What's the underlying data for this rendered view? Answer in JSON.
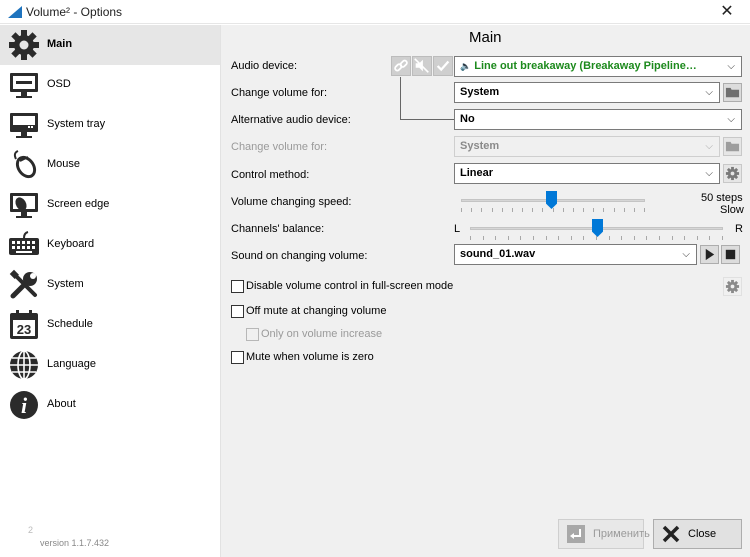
{
  "window": {
    "title": "Volume² - Options",
    "close_glyph": "✕",
    "version": "version 1.1.7.432",
    "logo_mark": "2"
  },
  "sidebar": {
    "items": [
      {
        "label": "Main",
        "icon": "gear-icon",
        "active": true
      },
      {
        "label": "OSD",
        "icon": "monitor-icon"
      },
      {
        "label": "System tray",
        "icon": "tray-icon"
      },
      {
        "label": "Mouse",
        "icon": "mouse-icon"
      },
      {
        "label": "Screen edge",
        "icon": "screen-edge-icon"
      },
      {
        "label": "Keyboard",
        "icon": "keyboard-icon"
      },
      {
        "label": "System",
        "icon": "tools-icon"
      },
      {
        "label": "Schedule",
        "icon": "calendar-icon",
        "icon_text": "23"
      },
      {
        "label": "Language",
        "icon": "globe-icon"
      },
      {
        "label": "About",
        "icon": "info-icon",
        "icon_text": "i"
      }
    ]
  },
  "main": {
    "title": "Main",
    "audio_device": {
      "label": "Audio device:",
      "value": "Line out breakaway (Breakaway Pipeline…",
      "speaker_glyph": "🔈",
      "value_color": "#1d8a1d"
    },
    "change_volume_for": {
      "label": "Change volume for:",
      "value": "System"
    },
    "alt_audio_device": {
      "label": "Alternative audio device:",
      "value": "No"
    },
    "change_volume_for_alt": {
      "label": "Change volume for:",
      "value": "System",
      "disabled": true
    },
    "control_method": {
      "label": "Control method:",
      "value": "Linear"
    },
    "volume_speed": {
      "label": "Volume changing speed:",
      "steps_text": "50 steps",
      "speed_text": "Slow",
      "position": 0.49
    },
    "channels_balance": {
      "label": "Channels' balance:",
      "left": "L",
      "right": "R",
      "position": 0.5
    },
    "sound_on_change": {
      "label": "Sound on changing volume:",
      "value": "sound_01.wav"
    },
    "checkboxes": [
      {
        "label": "Disable volume control in full-screen mode",
        "checked": false
      },
      {
        "label": "Off mute at changing volume",
        "checked": false
      },
      {
        "label": "Only on volume increase",
        "checked": false,
        "disabled": true
      },
      {
        "label": "Mute when volume is zero",
        "checked": false
      }
    ],
    "dropdown_glyph": "⌵"
  },
  "buttons": {
    "apply": "Применить",
    "close": "Close"
  },
  "colors": {
    "accent": "#0078d7",
    "active_nav": "#e6e6e6"
  }
}
